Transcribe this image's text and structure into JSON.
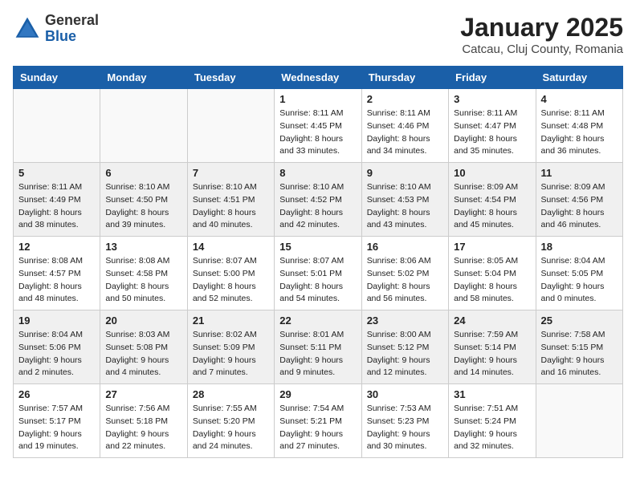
{
  "logo": {
    "general": "General",
    "blue": "Blue"
  },
  "header": {
    "month": "January 2025",
    "location": "Catcau, Cluj County, Romania"
  },
  "weekdays": [
    "Sunday",
    "Monday",
    "Tuesday",
    "Wednesday",
    "Thursday",
    "Friday",
    "Saturday"
  ],
  "weeks": [
    [
      {
        "day": "",
        "sunrise": "",
        "sunset": "",
        "daylight": ""
      },
      {
        "day": "",
        "sunrise": "",
        "sunset": "",
        "daylight": ""
      },
      {
        "day": "",
        "sunrise": "",
        "sunset": "",
        "daylight": ""
      },
      {
        "day": "1",
        "sunrise": "Sunrise: 8:11 AM",
        "sunset": "Sunset: 4:45 PM",
        "daylight": "Daylight: 8 hours and 33 minutes."
      },
      {
        "day": "2",
        "sunrise": "Sunrise: 8:11 AM",
        "sunset": "Sunset: 4:46 PM",
        "daylight": "Daylight: 8 hours and 34 minutes."
      },
      {
        "day": "3",
        "sunrise": "Sunrise: 8:11 AM",
        "sunset": "Sunset: 4:47 PM",
        "daylight": "Daylight: 8 hours and 35 minutes."
      },
      {
        "day": "4",
        "sunrise": "Sunrise: 8:11 AM",
        "sunset": "Sunset: 4:48 PM",
        "daylight": "Daylight: 8 hours and 36 minutes."
      }
    ],
    [
      {
        "day": "5",
        "sunrise": "Sunrise: 8:11 AM",
        "sunset": "Sunset: 4:49 PM",
        "daylight": "Daylight: 8 hours and 38 minutes."
      },
      {
        "day": "6",
        "sunrise": "Sunrise: 8:10 AM",
        "sunset": "Sunset: 4:50 PM",
        "daylight": "Daylight: 8 hours and 39 minutes."
      },
      {
        "day": "7",
        "sunrise": "Sunrise: 8:10 AM",
        "sunset": "Sunset: 4:51 PM",
        "daylight": "Daylight: 8 hours and 40 minutes."
      },
      {
        "day": "8",
        "sunrise": "Sunrise: 8:10 AM",
        "sunset": "Sunset: 4:52 PM",
        "daylight": "Daylight: 8 hours and 42 minutes."
      },
      {
        "day": "9",
        "sunrise": "Sunrise: 8:10 AM",
        "sunset": "Sunset: 4:53 PM",
        "daylight": "Daylight: 8 hours and 43 minutes."
      },
      {
        "day": "10",
        "sunrise": "Sunrise: 8:09 AM",
        "sunset": "Sunset: 4:54 PM",
        "daylight": "Daylight: 8 hours and 45 minutes."
      },
      {
        "day": "11",
        "sunrise": "Sunrise: 8:09 AM",
        "sunset": "Sunset: 4:56 PM",
        "daylight": "Daylight: 8 hours and 46 minutes."
      }
    ],
    [
      {
        "day": "12",
        "sunrise": "Sunrise: 8:08 AM",
        "sunset": "Sunset: 4:57 PM",
        "daylight": "Daylight: 8 hours and 48 minutes."
      },
      {
        "day": "13",
        "sunrise": "Sunrise: 8:08 AM",
        "sunset": "Sunset: 4:58 PM",
        "daylight": "Daylight: 8 hours and 50 minutes."
      },
      {
        "day": "14",
        "sunrise": "Sunrise: 8:07 AM",
        "sunset": "Sunset: 5:00 PM",
        "daylight": "Daylight: 8 hours and 52 minutes."
      },
      {
        "day": "15",
        "sunrise": "Sunrise: 8:07 AM",
        "sunset": "Sunset: 5:01 PM",
        "daylight": "Daylight: 8 hours and 54 minutes."
      },
      {
        "day": "16",
        "sunrise": "Sunrise: 8:06 AM",
        "sunset": "Sunset: 5:02 PM",
        "daylight": "Daylight: 8 hours and 56 minutes."
      },
      {
        "day": "17",
        "sunrise": "Sunrise: 8:05 AM",
        "sunset": "Sunset: 5:04 PM",
        "daylight": "Daylight: 8 hours and 58 minutes."
      },
      {
        "day": "18",
        "sunrise": "Sunrise: 8:04 AM",
        "sunset": "Sunset: 5:05 PM",
        "daylight": "Daylight: 9 hours and 0 minutes."
      }
    ],
    [
      {
        "day": "19",
        "sunrise": "Sunrise: 8:04 AM",
        "sunset": "Sunset: 5:06 PM",
        "daylight": "Daylight: 9 hours and 2 minutes."
      },
      {
        "day": "20",
        "sunrise": "Sunrise: 8:03 AM",
        "sunset": "Sunset: 5:08 PM",
        "daylight": "Daylight: 9 hours and 4 minutes."
      },
      {
        "day": "21",
        "sunrise": "Sunrise: 8:02 AM",
        "sunset": "Sunset: 5:09 PM",
        "daylight": "Daylight: 9 hours and 7 minutes."
      },
      {
        "day": "22",
        "sunrise": "Sunrise: 8:01 AM",
        "sunset": "Sunset: 5:11 PM",
        "daylight": "Daylight: 9 hours and 9 minutes."
      },
      {
        "day": "23",
        "sunrise": "Sunrise: 8:00 AM",
        "sunset": "Sunset: 5:12 PM",
        "daylight": "Daylight: 9 hours and 12 minutes."
      },
      {
        "day": "24",
        "sunrise": "Sunrise: 7:59 AM",
        "sunset": "Sunset: 5:14 PM",
        "daylight": "Daylight: 9 hours and 14 minutes."
      },
      {
        "day": "25",
        "sunrise": "Sunrise: 7:58 AM",
        "sunset": "Sunset: 5:15 PM",
        "daylight": "Daylight: 9 hours and 16 minutes."
      }
    ],
    [
      {
        "day": "26",
        "sunrise": "Sunrise: 7:57 AM",
        "sunset": "Sunset: 5:17 PM",
        "daylight": "Daylight: 9 hours and 19 minutes."
      },
      {
        "day": "27",
        "sunrise": "Sunrise: 7:56 AM",
        "sunset": "Sunset: 5:18 PM",
        "daylight": "Daylight: 9 hours and 22 minutes."
      },
      {
        "day": "28",
        "sunrise": "Sunrise: 7:55 AM",
        "sunset": "Sunset: 5:20 PM",
        "daylight": "Daylight: 9 hours and 24 minutes."
      },
      {
        "day": "29",
        "sunrise": "Sunrise: 7:54 AM",
        "sunset": "Sunset: 5:21 PM",
        "daylight": "Daylight: 9 hours and 27 minutes."
      },
      {
        "day": "30",
        "sunrise": "Sunrise: 7:53 AM",
        "sunset": "Sunset: 5:23 PM",
        "daylight": "Daylight: 9 hours and 30 minutes."
      },
      {
        "day": "31",
        "sunrise": "Sunrise: 7:51 AM",
        "sunset": "Sunset: 5:24 PM",
        "daylight": "Daylight: 9 hours and 32 minutes."
      },
      {
        "day": "",
        "sunrise": "",
        "sunset": "",
        "daylight": ""
      }
    ]
  ]
}
